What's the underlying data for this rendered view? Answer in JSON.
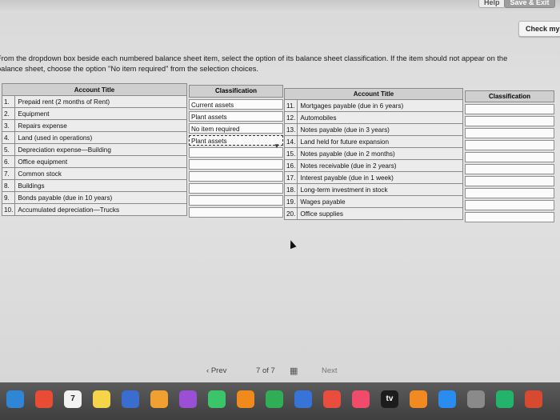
{
  "toolbar": {
    "help_label": "Help",
    "save_exit_label": "Save & Exit",
    "check_label": "Check my"
  },
  "instructions": "From the dropdown box beside each numbered balance sheet item, select the option of its balance sheet classification. If the item should not appear on the balance sheet, choose the option \"No item required\" from the selection choices.",
  "left_table": {
    "header_account": "Account Title",
    "header_class": "Classification",
    "rows": [
      {
        "num": "1.",
        "title": "Prepaid rent (2 months of Rent)"
      },
      {
        "num": "2.",
        "title": "Equipment"
      },
      {
        "num": "3.",
        "title": "Repairs expense"
      },
      {
        "num": "4.",
        "title": "Land (used in operations)"
      },
      {
        "num": "5.",
        "title": "Depreciation expense—Building"
      },
      {
        "num": "6.",
        "title": "Office equipment"
      },
      {
        "num": "7.",
        "title": "Common stock"
      },
      {
        "num": "8.",
        "title": "Buildings"
      },
      {
        "num": "9.",
        "title": "Bonds payable (due in 10 years)"
      },
      {
        "num": "10.",
        "title": "Accumulated depreciation—Trucks"
      }
    ],
    "selections": [
      "Current assets",
      "Plant assets",
      "No item required",
      "Plant assets",
      "",
      "",
      "",
      "",
      "",
      ""
    ]
  },
  "right_table": {
    "header_account": "Account Title",
    "header_class": "Classification",
    "rows": [
      {
        "num": "11.",
        "title": "Mortgages payable (due in 6 years)"
      },
      {
        "num": "12.",
        "title": "Automobiles"
      },
      {
        "num": "13.",
        "title": "Notes payable (due in 3 years)"
      },
      {
        "num": "14.",
        "title": "Land held for future expansion"
      },
      {
        "num": "15.",
        "title": "Notes payable (due in 2 months)"
      },
      {
        "num": "16.",
        "title": "Notes receivable (due in 2 years)"
      },
      {
        "num": "17.",
        "title": "Interest payable (due in 1 week)"
      },
      {
        "num": "18.",
        "title": "Long-term investment in stock"
      },
      {
        "num": "19.",
        "title": "Wages payable"
      },
      {
        "num": "20.",
        "title": "Office supplies"
      }
    ]
  },
  "pager": {
    "prev_label": "Prev",
    "current": "7",
    "of_label": "of",
    "total": "7",
    "next_label": "Next"
  },
  "dock": {
    "icons": [
      "finder-icon",
      "chrome-icon",
      "calendar-icon",
      "notes-icon",
      "app-icon",
      "photos-icon",
      "podcasts-icon",
      "facetime-icon",
      "pages-icon",
      "numbers-icon",
      "keynote-icon",
      "news-icon",
      "music-icon",
      "tv-icon",
      "books-icon",
      "appstore-icon",
      "settings-icon",
      "grammarly-icon",
      "app-icon-2"
    ],
    "tv_label": "tv",
    "calendar_day": "7"
  }
}
